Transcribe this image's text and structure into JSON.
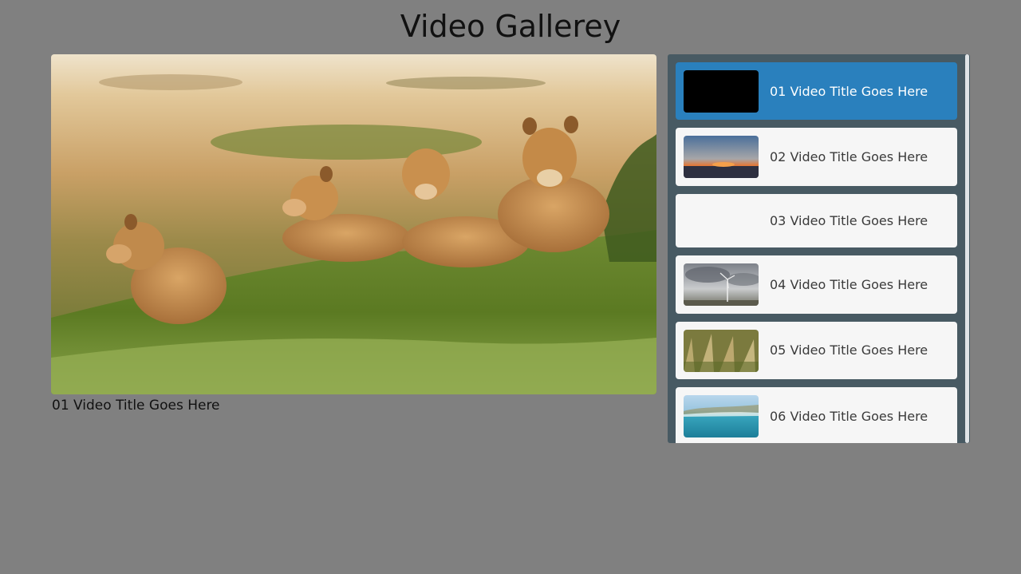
{
  "page": {
    "title": "Video Gallerey"
  },
  "player": {
    "current_title": "01 Video Title Goes Here",
    "thumbnail": "lionesses-in-savanna"
  },
  "playlist": {
    "items": [
      {
        "label": "01 Video Title Goes Here",
        "thumbnail": "black-frame",
        "active": true
      },
      {
        "label": "02 Video Title Goes Here",
        "thumbnail": "sunset-over-water",
        "active": false
      },
      {
        "label": "03 Video Title Goes Here",
        "thumbnail": "none",
        "active": false
      },
      {
        "label": "04 Video Title Goes Here",
        "thumbnail": "wind-turbine-cloudy-sky",
        "active": false
      },
      {
        "label": "05 Video Title Goes Here",
        "thumbnail": "grass-field",
        "active": false
      },
      {
        "label": "06 Video Title Goes Here",
        "thumbnail": "tropical-bay",
        "active": false
      }
    ]
  },
  "colors": {
    "background": "#808080",
    "playlist_panel": "#485a63",
    "active_item": "#2a80bd",
    "item": "#f6f6f6"
  }
}
